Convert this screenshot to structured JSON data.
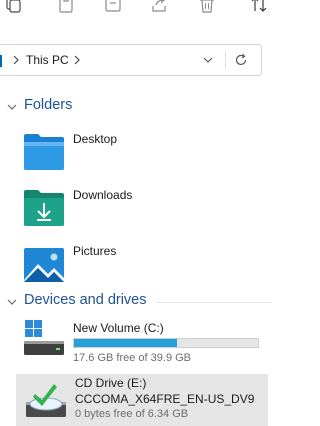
{
  "toolbar": {
    "icons": [
      "copy-icon",
      "paste-icon",
      "rename-icon",
      "share-icon",
      "delete-icon",
      "sort-icon"
    ]
  },
  "address": {
    "location": "This PC"
  },
  "sections": {
    "folders_title": "Folders",
    "drives_title": "Devices and drives"
  },
  "folders": [
    {
      "label": "Desktop",
      "icon": "desktop-folder-icon"
    },
    {
      "label": "Downloads",
      "icon": "downloads-folder-icon"
    },
    {
      "label": "Pictures",
      "icon": "pictures-folder-icon"
    }
  ],
  "drives": [
    {
      "name": "New Volume (C:)",
      "space": "17.6 GB free of 39.9 GB",
      "used_fraction": 0.559,
      "icon": "windows-drive-icon"
    },
    {
      "name": "CD Drive (E:)",
      "volume_label": "CCCOMA_X64FRE_EN-US_DV9",
      "space": "0 bytes free of 6.34 GB",
      "icon": "cd-drive-icon",
      "selected": true
    }
  ],
  "colors": {
    "accent": "#0067c0",
    "section_title": "#1e5294",
    "usage_fill": "#26a0da",
    "selection": "#e5e5e5"
  }
}
